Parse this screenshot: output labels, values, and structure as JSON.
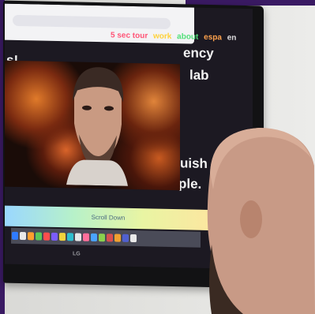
{
  "nav": [
    "5 sec tour",
    "work",
    "about",
    "espa",
    "en"
  ],
  "screen_fragments": [
    "s!",
    "ency",
    "lab",
    "uish",
    "ple."
  ],
  "taskbar_text": "Scroll Down",
  "tv_brand": "LG"
}
